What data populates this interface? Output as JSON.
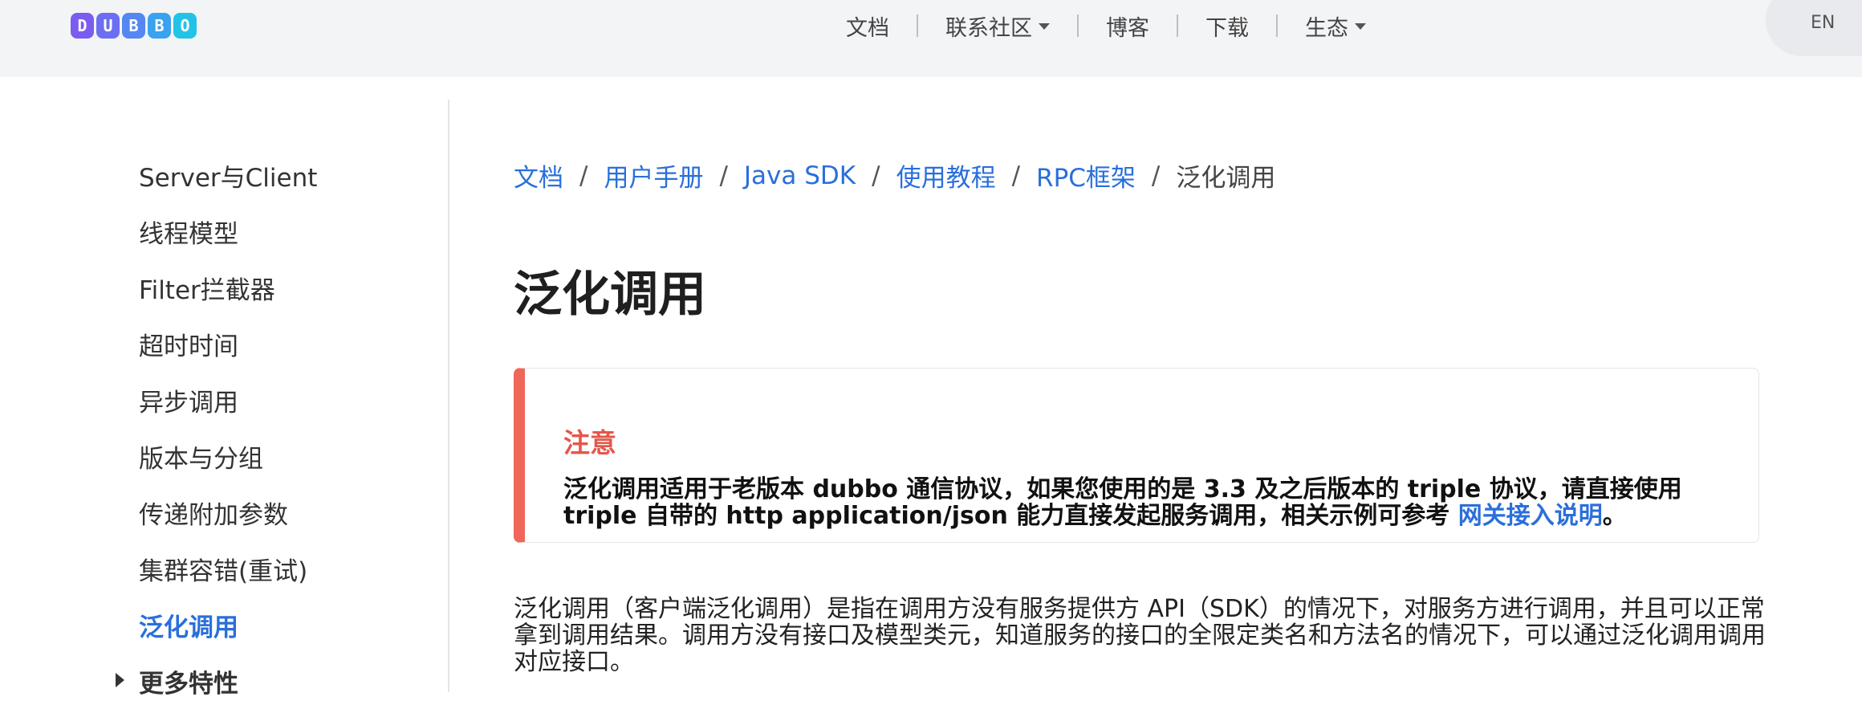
{
  "header": {
    "logo_letters": [
      "D",
      "U",
      "B",
      "B",
      "O"
    ],
    "logo_colors": [
      "#7b5cf0",
      "#6c6ff2",
      "#5587f2",
      "#3aa2ee",
      "#22c3e6"
    ],
    "nav": [
      {
        "label": "文档",
        "dropdown": false
      },
      {
        "label": "联系社区",
        "dropdown": true
      },
      {
        "label": "博客",
        "dropdown": false
      },
      {
        "label": "下载",
        "dropdown": false
      },
      {
        "label": "生态",
        "dropdown": true
      }
    ],
    "lang": "EN"
  },
  "sidebar": {
    "items": [
      {
        "label": "Server与Client"
      },
      {
        "label": "线程模型"
      },
      {
        "label": "Filter拦截器"
      },
      {
        "label": "超时时间"
      },
      {
        "label": "异步调用"
      },
      {
        "label": "版本与分组"
      },
      {
        "label": "传递附加参数"
      },
      {
        "label": "集群容错(重试)"
      },
      {
        "label": "泛化调用"
      },
      {
        "label": "更多特性"
      }
    ],
    "active_index": 8
  },
  "breadcrumb": {
    "links": [
      "文档",
      "用户手册",
      "Java SDK",
      "使用教程",
      "RPC框架"
    ],
    "separator": "/",
    "current": "泛化调用"
  },
  "page": {
    "title": "泛化调用",
    "alert": {
      "title": "注意",
      "body": "泛化调用适用于老版本 dubbo 通信协议，如果您使用的是 3.3 及之后版本的 triple 协议，请直接使用 triple 自带的 http application/json 能力直接发起服务调用，相关示例可参考",
      "link": "网关接入说明",
      "end": "。"
    },
    "paragraph": "泛化调用（客户端泛化调用）是指在调用方没有服务提供方 API（SDK）的情况下，对服务方进行调用，并且可以正常拿到调用结果。调用方没有接口及模型类元，知道服务的接口的全限定类名和方法名的情况下，可以通过泛化调用调用对应接口。"
  },
  "colors": {
    "link": "#2a6fdb",
    "alert_accent": "#f0675a",
    "header_bg": "#f3f4f6"
  }
}
